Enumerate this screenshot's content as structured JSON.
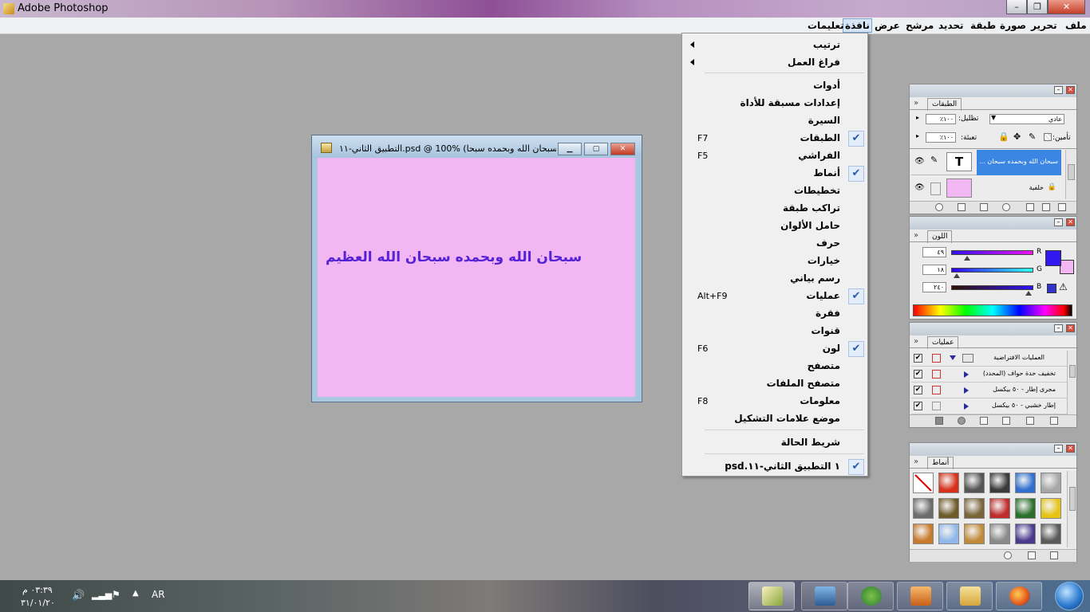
{
  "app": {
    "title": "Adobe Photoshop"
  },
  "menubar": {
    "items": [
      "ملف",
      "تحرير",
      "صورة",
      "طبقة",
      "تحديد",
      "مرشح",
      "عرض",
      "نافذة",
      "تعليمات"
    ],
    "active": "نافذة"
  },
  "window_menu": {
    "items": [
      {
        "label": "ترتيب",
        "submenu": true
      },
      {
        "label": "فراغ العمل",
        "submenu": true
      },
      {
        "label": "أدوات"
      },
      {
        "label": "إعدادات مسبقة للأداة"
      },
      {
        "label": "السيرة"
      },
      {
        "label": "الطبقات",
        "shortcut": "F7",
        "checked": true
      },
      {
        "label": "الفراشي",
        "shortcut": "F5"
      },
      {
        "label": "أنماط",
        "checked": true
      },
      {
        "label": "تخطيطات"
      },
      {
        "label": "تراكب طبقة"
      },
      {
        "label": "حامل الألوان"
      },
      {
        "label": "حرف"
      },
      {
        "label": "خيارات"
      },
      {
        "label": "رسم بياني"
      },
      {
        "label": "عمليات",
        "shortcut": "Alt+F9",
        "checked": true
      },
      {
        "label": "فقرة"
      },
      {
        "label": "قنوات"
      },
      {
        "label": "لون",
        "shortcut": "F6",
        "checked": true
      },
      {
        "label": "متصفح"
      },
      {
        "label": "متصفح الملفات"
      },
      {
        "label": "معلومات",
        "shortcut": "F8"
      },
      {
        "label": "موضع علامات التشكيل"
      },
      {
        "label": "شريط الحالة"
      },
      {
        "label": "١ التطبيق الثاني-١١.psd",
        "checked": true
      }
    ]
  },
  "document": {
    "title": "التطبيق الثاني-١١.psd @ 100% (سبحان الله وبحمده سبحا...",
    "canvas_text": "سبحان الله وبحمده سبحان الله العظيم",
    "canvas_color": "#f2b6f2",
    "text_color": "#5522d6"
  },
  "layers_panel": {
    "tab": "الطبقات",
    "blend_mode": "عادي",
    "opacity_label": "تظليل:",
    "opacity": "١٠٠٪",
    "lock_label": "تأمين:",
    "fill_label": "تعبئة:",
    "fill": "١٠٠٪",
    "layers": [
      {
        "name": "سبحان الله وبحمده سبحان ...",
        "type": "text",
        "thumb": "T",
        "selected": true
      },
      {
        "name": "خلفية",
        "type": "background",
        "selected": false
      }
    ]
  },
  "color_panel": {
    "tab": "اللون",
    "channels": [
      {
        "label": "R",
        "value": "٤٩",
        "fraction": 0.19
      },
      {
        "label": "G",
        "value": "١٨",
        "fraction": 0.07
      },
      {
        "label": "B",
        "value": "٢٤٠",
        "fraction": 0.94
      }
    ],
    "fg_color": "#3118f0",
    "bg_color": "#f2b6f2"
  },
  "actions_panel": {
    "tab": "عمليات",
    "rows": [
      {
        "label": "العمليات الافتراضية",
        "kind": "set"
      },
      {
        "label": "تخفيف حدة حواف (المحدد)",
        "kind": "action"
      },
      {
        "label": "مجرى إطار - ٥٠ بيكسل",
        "kind": "action"
      },
      {
        "label": "إطار خشبي - ٥٠ بيكسل",
        "kind": "action"
      }
    ]
  },
  "styles_panel": {
    "tab": "أنماط",
    "swatches": [
      "none",
      "#d8301a",
      "#555555",
      "#3a3a3a",
      "#2f6fce",
      "#a6a6a6",
      "#6c6c6c",
      "#6f5b2a",
      "#7a6538",
      "#c02b2b",
      "#2b6f2b",
      "#e6c315",
      "#c87a2b",
      "#8fb7e8",
      "#c18a3a",
      "#8a8a8a",
      "#4a3a8e",
      "#5a5a5a"
    ]
  },
  "taskbar": {
    "language": "AR",
    "time": "٠٣:٣٩ م",
    "date": "٣١/٠١/٢٠"
  }
}
